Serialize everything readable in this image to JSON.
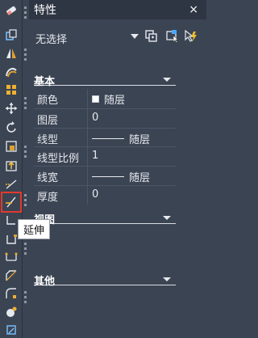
{
  "panel": {
    "title": "特性",
    "close_glyph": "×",
    "selection": "无选择",
    "quick_icons": [
      "toggle-pickadd-icon",
      "select-objects-icon",
      "quick-select-icon"
    ]
  },
  "sections": {
    "general": {
      "label": "基本"
    },
    "view": {
      "label": "视图"
    },
    "misc": {
      "label": "其他"
    }
  },
  "properties": [
    {
      "name": "颜色",
      "value": "随层",
      "kind": "color",
      "color": "#ffffff"
    },
    {
      "name": "图层",
      "value": "0",
      "kind": "text"
    },
    {
      "name": "线型",
      "value": "随层",
      "kind": "line"
    },
    {
      "name": "线型比例",
      "value": "1",
      "kind": "text"
    },
    {
      "name": "线宽",
      "value": "随层",
      "kind": "line"
    },
    {
      "name": "厚度",
      "value": "0",
      "kind": "text"
    }
  ],
  "toolbar": {
    "tools": [
      "erase-icon",
      "copy-icon",
      "mirror-icon",
      "offset-icon",
      "array-icon",
      "move-icon",
      "rotate-icon",
      "scale-icon",
      "stretch-icon",
      "trim-icon",
      "extend-icon",
      "break-at-point-icon",
      "break-icon",
      "join-icon",
      "chamfer-icon",
      "fillet-icon",
      "blend-icon",
      "explode-icon"
    ],
    "active_tooltip": "延伸"
  },
  "colors": {
    "background": "#3b4453",
    "titlebar": "#2f3643",
    "active_outline": "#e23a2e"
  }
}
